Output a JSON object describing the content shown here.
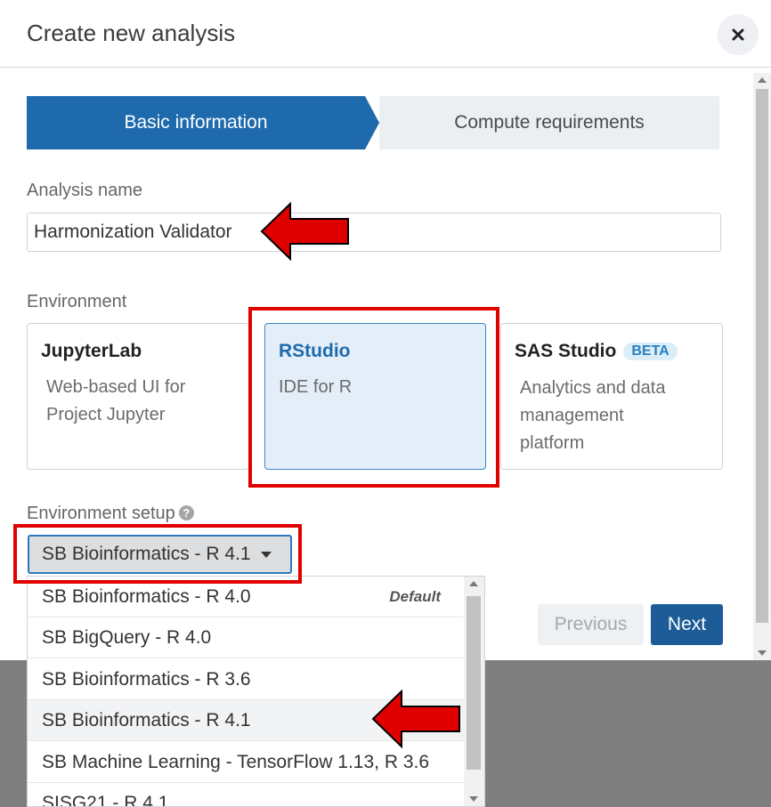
{
  "dialog": {
    "title": "Create new analysis",
    "close_icon": "close-icon"
  },
  "stepper": {
    "steps": [
      {
        "label": "Basic information",
        "state": "active"
      },
      {
        "label": "Compute requirements",
        "state": "inactive"
      }
    ]
  },
  "form": {
    "analysis_name_label": "Analysis name",
    "analysis_name_value": "Harmonization Validator",
    "environment_label": "Environment",
    "environments": [
      {
        "title": "JupyterLab",
        "description_lines": [
          "Web-based UI for",
          "Project Jupyter"
        ],
        "selected": false
      },
      {
        "title": "RStudio",
        "description_lines": [
          "IDE for R"
        ],
        "selected": true
      },
      {
        "title": "SAS Studio",
        "badge": "BETA",
        "description_lines": [
          "Analytics and data",
          "management",
          "platform"
        ],
        "selected": false
      }
    ],
    "environment_setup_label": "Environment setup",
    "environment_setup_help_icon": "question-circle-icon",
    "environment_setup_selected": "SB Bioinformatics - R 4.1"
  },
  "dropdown": {
    "options": [
      {
        "label": "SB Bioinformatics - R 4.0",
        "tag": "Default"
      },
      {
        "label": "SB BigQuery - R 4.0"
      },
      {
        "label": "SB Bioinformatics - R 3.6"
      },
      {
        "label": "SB Bioinformatics - R 4.1",
        "highlighted": true
      },
      {
        "label": "SB Machine Learning - TensorFlow 1.13, R 3.6"
      },
      {
        "label": "SISG21 - R 4.1"
      }
    ]
  },
  "footer": {
    "previous_label": "Previous",
    "next_label": "Next"
  },
  "colors": {
    "primary": "#1e6aad",
    "next_button": "#1e5c98",
    "annotation": "#e00000",
    "selected_card_bg": "#e3eef8"
  }
}
